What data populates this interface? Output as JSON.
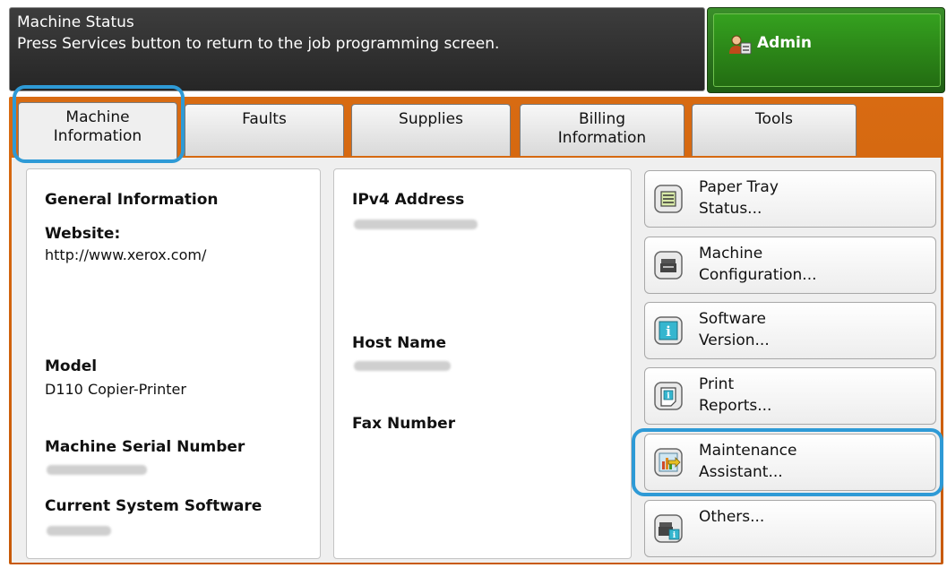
{
  "status": {
    "title": "Machine Status",
    "message": "Press Services button to return to the job programming screen."
  },
  "admin": {
    "label": "Admin",
    "icon": "admin-user-icon"
  },
  "tabs": [
    {
      "label": "Machine\nInformation",
      "active": true
    },
    {
      "label": "Faults",
      "active": false
    },
    {
      "label": "Supplies",
      "active": false
    },
    {
      "label": "Billing\nInformation",
      "active": false
    },
    {
      "label": "Tools",
      "active": false
    }
  ],
  "general": {
    "heading": "General Information",
    "website_label": "Website:",
    "website_value": "http://www.xerox.com/",
    "model_label": "Model",
    "model_value": "D110 Copier-Printer",
    "serial_label": "Machine Serial Number",
    "software_label": "Current System Software"
  },
  "network": {
    "ipv4_label": "IPv4 Address",
    "host_label": "Host Name",
    "fax_label": "Fax Number"
  },
  "buttons": [
    {
      "label": "Paper Tray\nStatus...",
      "icon": "paper-tray-icon"
    },
    {
      "label": "Machine\nConfiguration...",
      "icon": "machine-config-icon"
    },
    {
      "label": "Software\nVersion...",
      "icon": "info-icon"
    },
    {
      "label": "Print\nReports...",
      "icon": "print-reports-icon"
    },
    {
      "label": "Maintenance\nAssistant...",
      "icon": "maintenance-icon"
    },
    {
      "label": "Others...",
      "icon": "others-icon"
    }
  ],
  "colors": {
    "accent_orange": "#d0620c",
    "admin_green": "#2f8a1c",
    "highlight_blue": "#2e9ad6"
  }
}
